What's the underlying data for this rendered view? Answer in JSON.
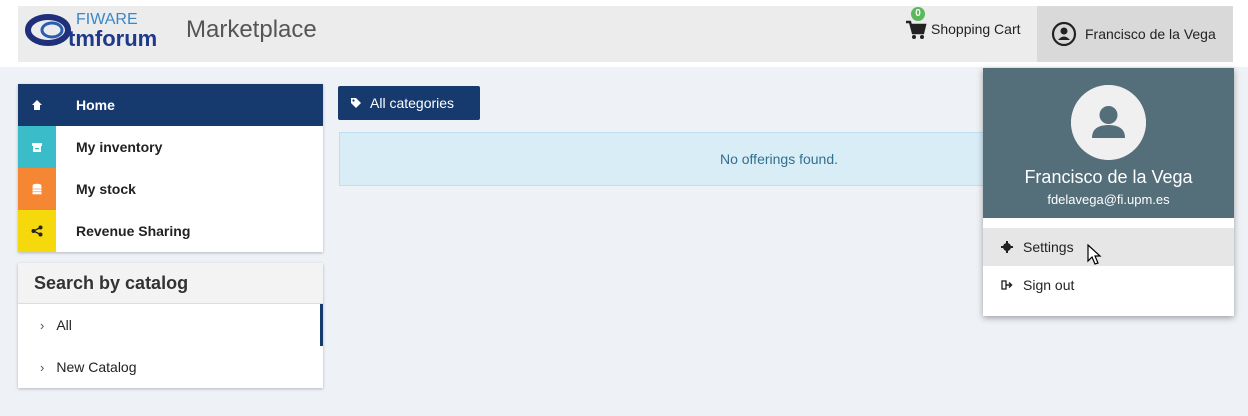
{
  "header": {
    "logo_top": "FIWARE",
    "logo_bottom": "tmforum",
    "brand": "Marketplace",
    "cart_label": "Shopping Cart",
    "cart_count": "0",
    "user_name": "Francisco de la Vega",
    "cart_icon": "cart-icon",
    "user_icon": "user-circle-icon"
  },
  "nav": {
    "items": [
      {
        "label": "Home",
        "icon": "home-icon",
        "color": "#163a6e"
      },
      {
        "label": "My inventory",
        "icon": "archive-icon",
        "color": "#3bbdc9"
      },
      {
        "label": "My stock",
        "icon": "database-icon",
        "color": "#f58634"
      },
      {
        "label": "Revenue Sharing",
        "icon": "share-icon",
        "color": "#f5d90c"
      }
    ]
  },
  "catalog": {
    "title": "Search by catalog",
    "items": [
      {
        "label": "All"
      },
      {
        "label": "New Catalog"
      }
    ]
  },
  "categories_button": "All categories",
  "empty_message": "No offerings found.",
  "dropdown": {
    "name": "Francisco de la Vega",
    "email": "fdelavega@fi.upm.es",
    "settings_label": "Settings",
    "signout_label": "Sign out"
  }
}
